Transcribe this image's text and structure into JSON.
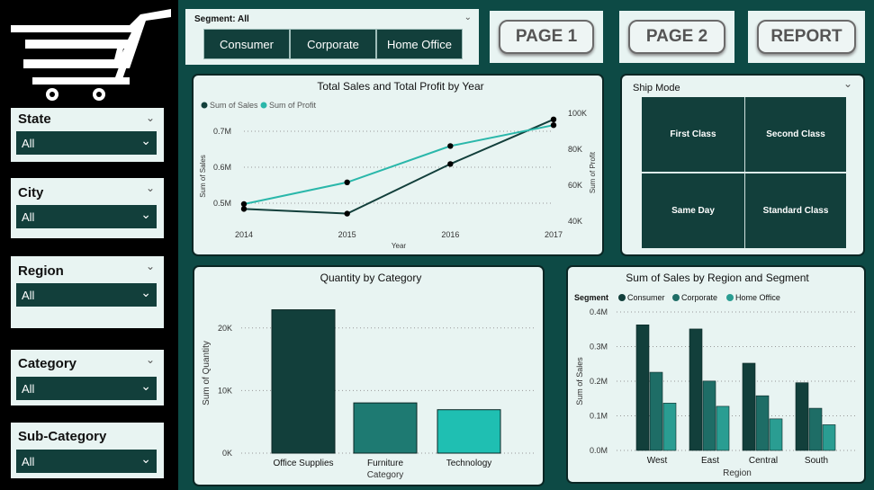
{
  "slicers": [
    {
      "title": "State",
      "value": "All"
    },
    {
      "title": "City",
      "value": "All"
    },
    {
      "title": "Region",
      "value": "All"
    },
    {
      "title": "Category",
      "value": "All"
    },
    {
      "title": "Sub-Category",
      "value": "All"
    }
  ],
  "segment": {
    "label": "Segment: All",
    "options": [
      "Consumer",
      "Corporate",
      "Home Office"
    ]
  },
  "nav": {
    "page1": "PAGE 1",
    "page2": "PAGE 2",
    "report": "REPORT"
  },
  "ship_mode": {
    "title": "Ship Mode",
    "options": [
      "First Class",
      "Second Class",
      "Same Day",
      "Standard Class"
    ]
  },
  "colors": {
    "dark_teal": "#123f3b",
    "mid_teal": "#1e7a72",
    "light_teal": "#2ab7aa",
    "background": "#0d4a45"
  },
  "chart_data": [
    {
      "type": "line",
      "title": "Total Sales and Total Profit by Year",
      "x": [
        "2014",
        "2015",
        "2016",
        "2017"
      ],
      "xlabel": "Year",
      "series": [
        {
          "name": "Sum of Sales",
          "axis": "left",
          "values": [
            0.484,
            0.471,
            0.609,
            0.733
          ],
          "color": "#123f3b"
        },
        {
          "name": "Sum of Profit",
          "axis": "right",
          "values": [
            49500,
            61600,
            81800,
            93400
          ],
          "color": "#2ab7aa"
        }
      ],
      "ylabel_left": "Sum of Sales",
      "ylabel_right": "Sum of Profit",
      "left_ticks": [
        "0.5M",
        "0.6M",
        "0.7M"
      ],
      "right_ticks": [
        "40K",
        "60K",
        "80K",
        "100K"
      ],
      "legend": "top-left"
    },
    {
      "type": "bar",
      "title": "Quantity by Category",
      "categories": [
        "Office Supplies",
        "Furniture",
        "Technology"
      ],
      "values": [
        22906,
        8028,
        6939
      ],
      "colors": [
        "#123f3b",
        "#1e7a72",
        "#1fbfb2"
      ],
      "xlabel": "Category",
      "ylabel": "Sum of Quantity",
      "ylim": [
        0,
        25000
      ],
      "ticks": [
        "0K",
        "10K",
        "20K"
      ]
    },
    {
      "type": "bar",
      "title": "Sum of Sales by Region and Segment",
      "legend_title": "Segment",
      "categories": [
        "West",
        "East",
        "Central",
        "South"
      ],
      "series": [
        {
          "name": "Consumer",
          "values": [
            362880,
            350908,
            252031,
            195581
          ],
          "color": "#123f3b"
        },
        {
          "name": "Corporate",
          "values": [
            225855,
            200409,
            157996,
            121886
          ],
          "color": "#1e6d66"
        },
        {
          "name": "Home Office",
          "values": [
            136722,
            127464,
            91213,
            74255
          ],
          "color": "#2a9d92"
        }
      ],
      "xlabel": "Region",
      "ylabel": "Sum of Sales",
      "ylim": [
        0,
        400000
      ],
      "ticks": [
        "0.0M",
        "0.1M",
        "0.2M",
        "0.3M",
        "0.4M"
      ],
      "legend": "top-left"
    }
  ]
}
